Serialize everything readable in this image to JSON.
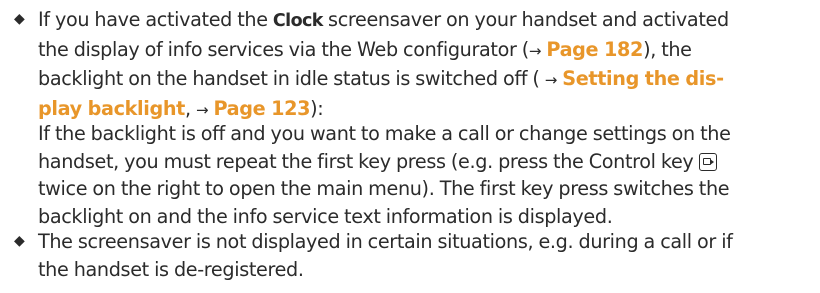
{
  "bullet_glyph": "◆",
  "arrow_glyph": "→",
  "ref_color": "#e8962a",
  "text_color": "#2b2b2b",
  "item1": {
    "l1_a": "If you have activated the ",
    "l1_ui": "Clock",
    "l1_b": " screensaver on your handset and activated",
    "l2_a": "the display of info services via the Web configurator (",
    "l2_ref": "Page 182",
    "l2_b": "), the",
    "l3_a": "backlight on the handset in idle status is switched off ( ",
    "l3_ref": "Setting the dis-",
    "l4_ref": "play backlight",
    "l4_b": ", ",
    "l4_ref2": "Page 123",
    "l4_c": "):",
    "p2_l1": "If the backlight is off and you want to make a call or change settings on the",
    "p2_l2_a": "handset, you must repeat the first key press (e.g. press the Control key ",
    "p2_l3": "twice on the right to open the main menu). The first key press switches the",
    "p2_l4": "backlight on and the info service text information is displayed.",
    "key_icon": "control-key-right-icon"
  },
  "item2": {
    "l1": "The screensaver is not displayed in certain situations, e.g. during a call or if",
    "l2": "the handset is de-registered."
  }
}
